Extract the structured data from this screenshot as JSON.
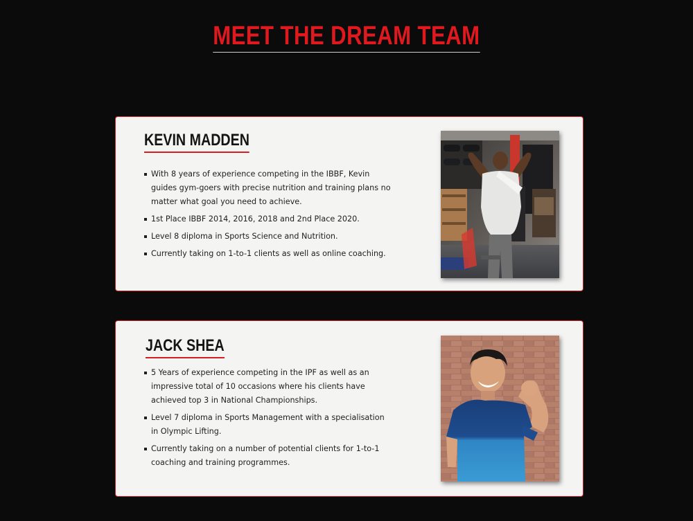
{
  "heading": "MEET THE DREAM TEAM",
  "team": [
    {
      "name": "KEVIN MADDEN",
      "bullets": [
        "With 8 years of experience competing in the IBBF, Kevin guides gym-goers with precise nutrition and training plans no matter what goal you need to achieve.",
        "1st Place IBBF 2014, 2016, 2018 and 2nd Place 2020.",
        "Level 8 diploma in Sports Science and Nutrition.",
        "Currently taking on 1-to-1 clients as well as online coaching."
      ]
    },
    {
      "name": "JACK SHEA",
      "bullets": [
        "5 Years of experience competing in the IPF as well as an impressive total of 10 occasions where his clients have achieved top 3 in National Championships.",
        "Level 7 diploma in Sports Management with a specialisation in Olympic Lifting.",
        "Currently taking on a number of potential clients for 1-to-1 coaching and training programmes."
      ]
    }
  ],
  "colors": {
    "background": "#0c0b0b",
    "accent": "#e0191e",
    "card": "#f4f4f3"
  }
}
